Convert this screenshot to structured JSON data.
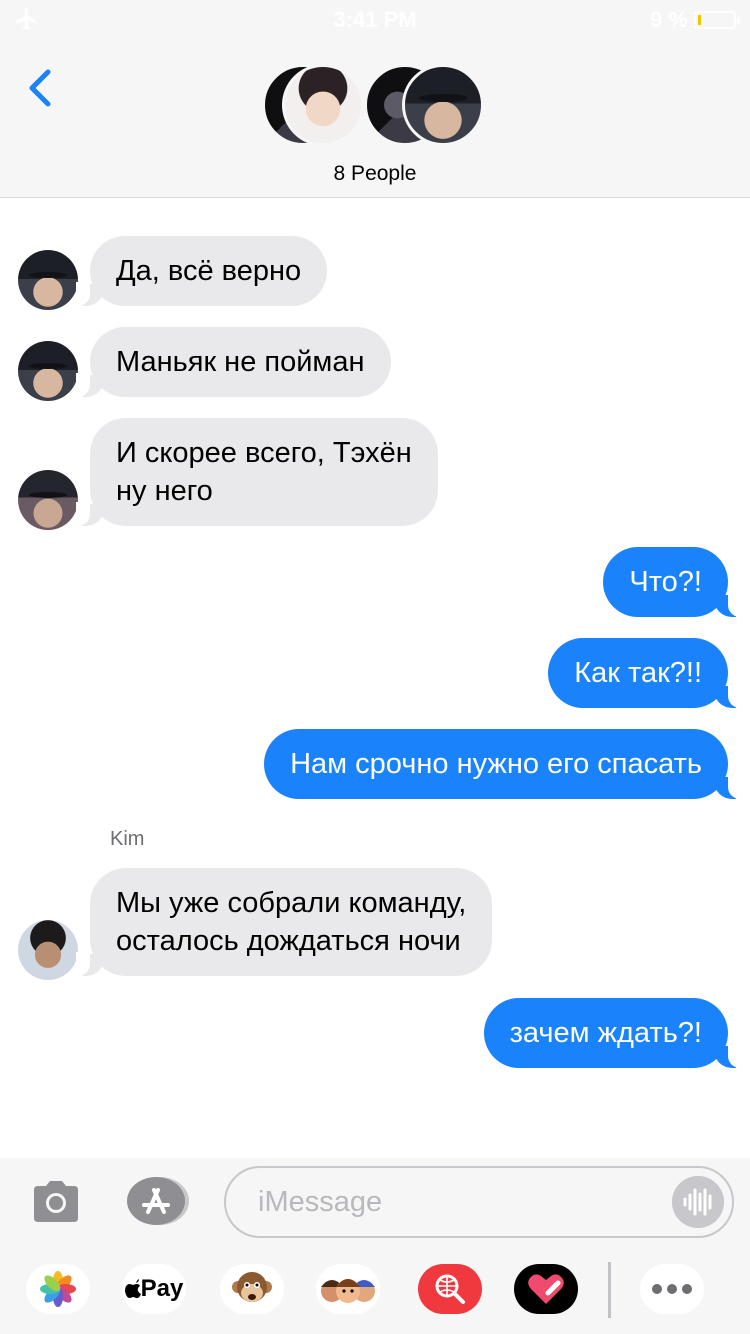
{
  "status_bar": {
    "time": "3:41 PM",
    "battery_percent": "9 %",
    "battery_level": 0.09
  },
  "header": {
    "back_icon": "chevron-left-icon",
    "group_label": "8 People",
    "avatars": [
      "avatar-group-member",
      "avatar-group-member",
      "avatar-group-member",
      "avatar-group-member"
    ]
  },
  "messages": [
    {
      "direction": "incoming",
      "lines": [
        "Да, всё верно"
      ]
    },
    {
      "direction": "incoming",
      "lines": [
        "Маньяк не пойман"
      ]
    },
    {
      "direction": "incoming",
      "lines": [
        "И скорее всего, Тэхён",
        "ну него"
      ]
    },
    {
      "direction": "outgoing",
      "lines": [
        "Что?!"
      ]
    },
    {
      "direction": "outgoing",
      "lines": [
        "Как так?!!"
      ]
    },
    {
      "direction": "outgoing",
      "lines": [
        "Нам срочно нужно его спасать"
      ]
    },
    {
      "direction": "incoming",
      "sender": "Kim",
      "lines": [
        "Мы уже собрали команду,",
        "осталось дождаться ночи"
      ]
    },
    {
      "direction": "outgoing",
      "lines": [
        "зачем ждать?!"
      ]
    }
  ],
  "input": {
    "placeholder": "iMessage",
    "camera_icon": "camera-icon",
    "appstore_icon": "app-store-icon",
    "audio_icon": "audio-waveform-icon"
  },
  "app_drawer": {
    "apple_pay_label": "Pay",
    "items": [
      "photos-icon",
      "apple-pay-icon",
      "animoji-icon",
      "memoji-icon",
      "web-search-icon",
      "digital-touch-icon",
      "more-icon"
    ]
  },
  "colors": {
    "outgoing_bubble": "#1a82fb",
    "incoming_bubble": "#e9e9eb",
    "accent": "#1a82fb"
  }
}
